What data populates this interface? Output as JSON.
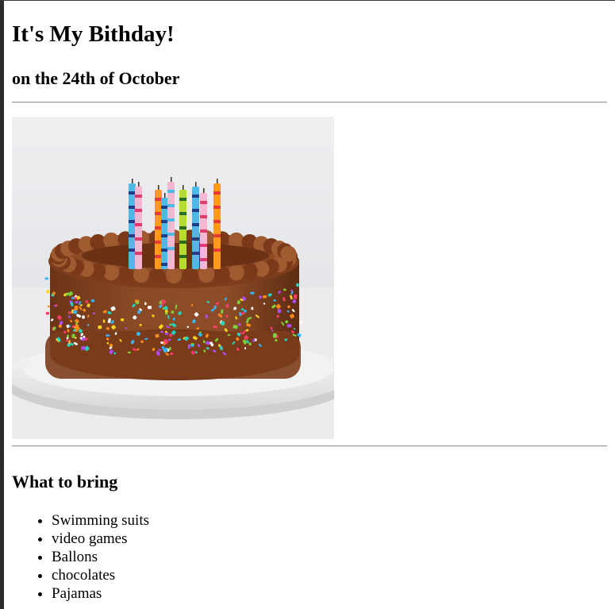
{
  "page": {
    "title": "It's My Bithday!",
    "subtitle": "on the 24th of October"
  },
  "image": {
    "icon": "birthday-cake-image"
  },
  "bring": {
    "heading": "What to bring",
    "items": [
      "Swimming suits",
      "video games",
      "Ballons",
      "chocolates",
      "Pajamas"
    ]
  },
  "colors": {
    "frosting": "#7a3e1e",
    "plate": "#f4f4f4",
    "background": "#e9eaec"
  }
}
